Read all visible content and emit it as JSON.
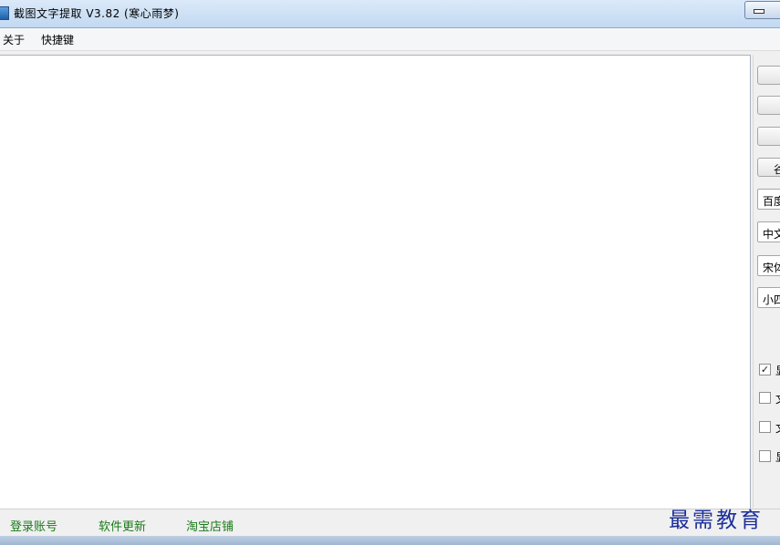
{
  "window": {
    "title": "截图文字提取 V3.82 (寒心雨梦)"
  },
  "menu": {
    "items": [
      "关于",
      "快捷键"
    ]
  },
  "editor": {
    "content": ""
  },
  "right_panel": {
    "buttons": [
      "",
      "",
      "",
      "谷"
    ],
    "selects": [
      "百度",
      "中文",
      "宋体",
      "小四"
    ],
    "checkboxes": [
      {
        "label": "显",
        "checked": true
      },
      {
        "label": "文",
        "checked": false
      },
      {
        "label": "文",
        "checked": false
      },
      {
        "label": "显",
        "checked": false
      }
    ]
  },
  "status": {
    "links": [
      "登录账号",
      "软件更新",
      "淘宝店铺"
    ]
  },
  "watermark": "最需教育",
  "colors": {
    "link": "#1a7a1a",
    "watermark": "#1b2e9a",
    "titlebar": "#c2d9f2"
  }
}
